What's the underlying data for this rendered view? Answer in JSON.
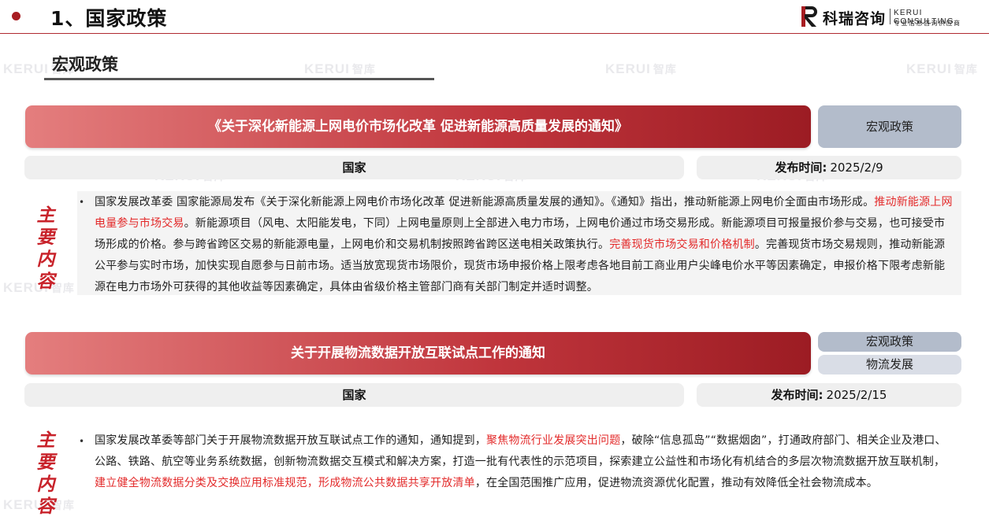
{
  "header": {
    "title": "1、国家政策",
    "logo_cn": "科瑞咨询",
    "logo_en": "KERUI CONSULTING",
    "logo_en_sub": "专业信息咨询供应商"
  },
  "watermark": {
    "en": "KERUI",
    "cn": "智库"
  },
  "section": {
    "title": "宏观政策"
  },
  "policies": [
    {
      "title": "《关于深化新能源上网电价市场化改革 促进新能源高质量发展的通知》",
      "tags": [
        "宏观政策"
      ],
      "country": "国家",
      "date_label": "发布时间:",
      "date": "2025/2/9",
      "side_label": [
        "主",
        "要",
        "内",
        "容"
      ],
      "content": [
        {
          "text": "国家发展改革委 国家能源局发布《关于深化新能源上网电价市场化改革 促进新能源高质量发展的通知》。《通知》指出，推动新能源上网电价全面由市场形成。",
          "hl": false
        },
        {
          "text": "推动新能源上网电量参与市场交易",
          "hl": true
        },
        {
          "text": "。新能源项目（风电、太阳能发电，下同）上网电量原则上全部进入电力市场，上网电价通过市场交易形成。新能源项目可报量报价参与交易，也可接受市场形成的价格。参与跨省跨区交易的新能源电量，上网电价和交易机制按照跨省跨区送电相关政策执行。",
          "hl": false
        },
        {
          "text": "完善现货市场交易和价格机制",
          "hl": true
        },
        {
          "text": "。完善现货市场交易规则，推动新能源公平参与实时市场，加快实现自愿参与日前市场。适当放宽现货市场限价，现货市场申报价格上限考虑各地目前工商业用户尖峰电价水平等因素确定，申报价格下限考虑新能源在电力市场外可获得的其他收益等因素确定，具体由省级价格主管部门商有关部门制定并适时调整。",
          "hl": false
        }
      ]
    },
    {
      "title": "关于开展物流数据开放互联试点工作的通知",
      "tags": [
        "宏观政策",
        "物流发展"
      ],
      "country": "国家",
      "date_label": "发布时间:",
      "date": "2025/2/15",
      "side_label": [
        "主",
        "要",
        "内",
        "容"
      ],
      "content": [
        {
          "text": "国家发展改革委等部门关于开展物流数据开放互联试点工作的通知，通知提到，",
          "hl": false
        },
        {
          "text": "聚焦物流行业发展突出问题",
          "hl": true
        },
        {
          "text": "，破除“信息孤岛”“数据烟囱”，打通政府部门、相关企业及港口、公路、铁路、航空等业务系统数据，创新物流数据交互模式和解决方案，打造一批有代表性的示范项目，探索建立公益性和市场化有机结合的多层次物流数据开放互联机制，",
          "hl": false
        },
        {
          "text": "建立健全物流数据分类及交换应用标准规范，形成物流公共数据共享开放清单",
          "hl": true
        },
        {
          "text": "，在全国范围推广应用，促进物流资源优化配置，推动有效降低全社会物流成本。",
          "hl": false
        }
      ]
    }
  ],
  "colors": {
    "accent": "#a81d22",
    "highlight": "#e32b2b",
    "tag": "#b3bccb"
  }
}
